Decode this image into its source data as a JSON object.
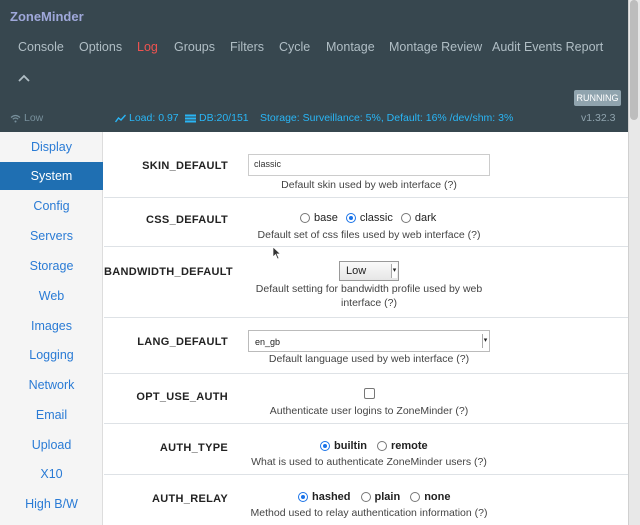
{
  "app": {
    "brand": "ZoneMinder"
  },
  "menu": [
    {
      "label": "Console"
    },
    {
      "label": "Options"
    },
    {
      "label": "Log"
    },
    {
      "label": "Groups"
    },
    {
      "label": "Filters"
    },
    {
      "label": "Cycle"
    },
    {
      "label": "Montage"
    },
    {
      "label": "Montage Review"
    },
    {
      "label": "Audit Events Report"
    }
  ],
  "status": {
    "running": "RUNNING",
    "bandwidth": "Low",
    "load": "Load: 0.97",
    "db": "DB:20/151",
    "storage": "Storage: Surveillance: 5%, Default: 16% /dev/shm: 3%",
    "version": "v1.32.3"
  },
  "sidebar": {
    "items": [
      {
        "label": "Display"
      },
      {
        "label": "System"
      },
      {
        "label": "Config"
      },
      {
        "label": "Servers"
      },
      {
        "label": "Storage"
      },
      {
        "label": "Web"
      },
      {
        "label": "Images"
      },
      {
        "label": "Logging"
      },
      {
        "label": "Network"
      },
      {
        "label": "Email"
      },
      {
        "label": "Upload"
      },
      {
        "label": "X10"
      },
      {
        "label": "High B/W"
      }
    ]
  },
  "options": {
    "skin_default": {
      "name": "SKIN_DEFAULT",
      "value": "classic",
      "help": "Default skin used by web interface (?)"
    },
    "css_default": {
      "name": "CSS_DEFAULT",
      "choices": [
        "base",
        "classic",
        "dark"
      ],
      "help": "Default set of css files used by web interface (?)"
    },
    "bandwidth_default": {
      "name": "BANDWIDTH_DEFAULT",
      "value": "Low",
      "help": "Default setting for bandwidth profile used by web interface (?)"
    },
    "lang_default": {
      "name": "LANG_DEFAULT",
      "value": "en_gb",
      "help": "Default language used by web interface (?)"
    },
    "opt_use_auth": {
      "name": "OPT_USE_AUTH",
      "help": "Authenticate user logins to ZoneMinder (?)"
    },
    "auth_type": {
      "name": "AUTH_TYPE",
      "choices": [
        "builtin",
        "remote"
      ],
      "help": "What is used to authenticate ZoneMinder users (?)"
    },
    "auth_relay": {
      "name": "AUTH_RELAY",
      "choices": [
        "hashed",
        "plain",
        "none"
      ],
      "help": "Method used to relay authentication information (?)"
    }
  }
}
